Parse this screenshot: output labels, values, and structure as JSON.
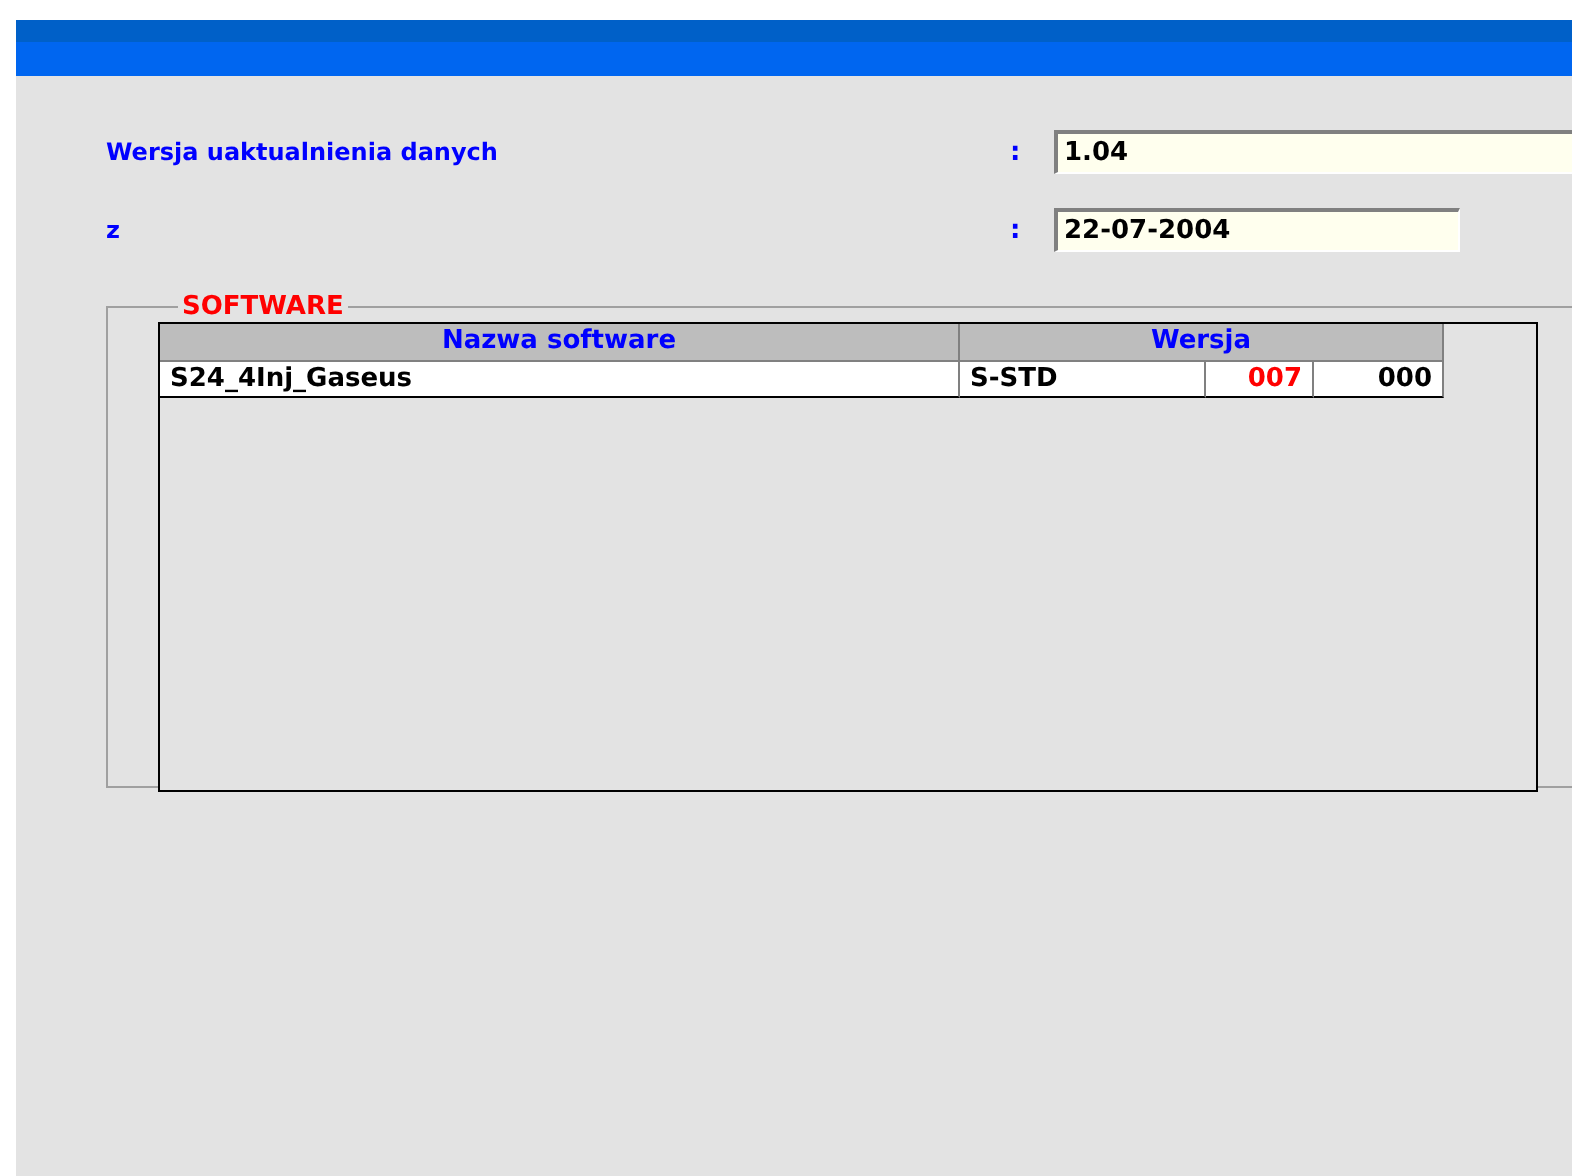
{
  "fields": [
    {
      "label": "Wersja uaktualnienia danych",
      "separator": ":",
      "value": "1.04"
    },
    {
      "label": "z",
      "separator": ":",
      "value": "22-07-2004"
    }
  ],
  "software": {
    "title": "SOFTWARE",
    "columns": [
      "Nazwa software",
      "Wersja"
    ],
    "rows": [
      {
        "name": "S24_4Inj_Gaseus",
        "version": "S-STD",
        "major": "007",
        "minor": "000"
      }
    ]
  }
}
